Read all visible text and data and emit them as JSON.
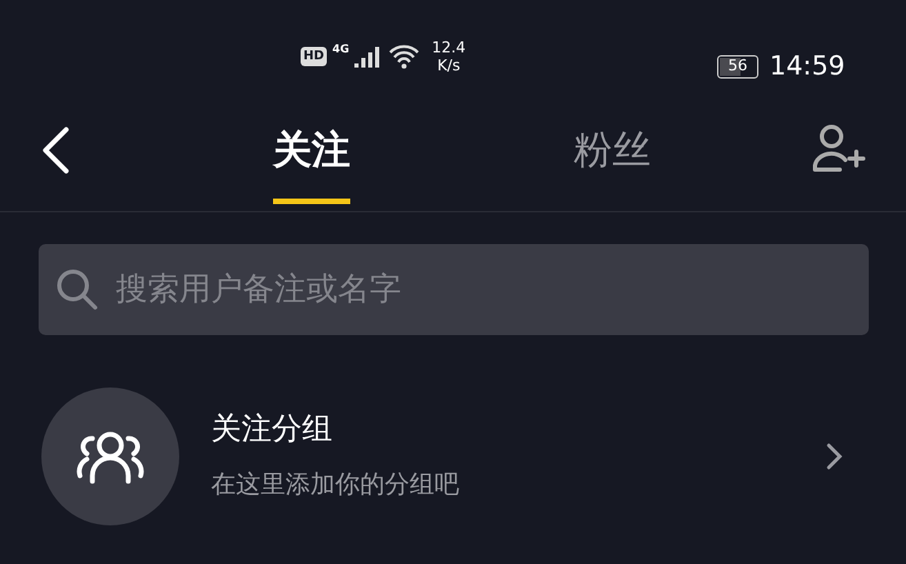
{
  "status_bar": {
    "hd": "HD",
    "network": "4G",
    "speed_value": "12.4",
    "speed_unit": "K/s",
    "battery": "56",
    "time": "14:59"
  },
  "tabs": [
    {
      "label": "关注",
      "selected": true
    },
    {
      "label": "粉丝",
      "selected": false
    }
  ],
  "search": {
    "placeholder": "搜索用户备注或名字"
  },
  "group_row": {
    "title": "关注分组",
    "subtitle": "在这里添加你的分组吧"
  }
}
